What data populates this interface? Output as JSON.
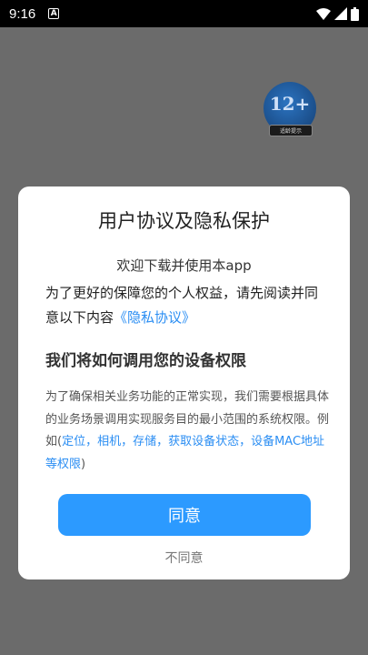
{
  "status_bar": {
    "time": "9:16",
    "notification_glyph": "A",
    "icons": [
      "wifi-icon",
      "signal-icon",
      "battery-icon"
    ]
  },
  "age_rating": {
    "label": "12+",
    "caption": "适龄提示"
  },
  "dialog": {
    "title": "用户协议及隐私保护",
    "welcome": "欢迎下载并使用本app",
    "intro_text": "为了更好的保障您的个人权益，请先阅读并同意以下内容",
    "privacy_link": "《隐私协议》",
    "section_title": "我们将如何调用您的设备权限",
    "permission_text": "为了确保相关业务功能的正常实现，我们需要根据具体的业务场景调用实现服务目的最小范围的系统权限。例如(",
    "permission_examples": "定位，相机，存储，获取设备状态，设备MAC地址等权限",
    "permission_close": ")",
    "agree_label": "同意",
    "disagree_label": "不同意"
  },
  "colors": {
    "accent": "#2c9aff",
    "link": "#2b8ef3",
    "backdrop": "#6b6b6b"
  }
}
